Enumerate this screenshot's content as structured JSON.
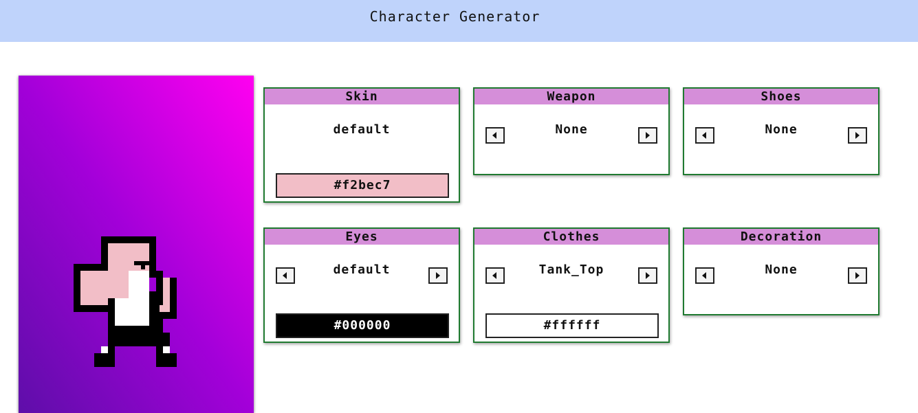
{
  "header": {
    "title": "Character Generator"
  },
  "preview": {
    "gradient": [
      "#5e0ea9",
      "#a300d9",
      "#ff00f0"
    ],
    "skin_color": "#f2bec7",
    "eye_color": "#000000",
    "clothes_color": "#ffffff"
  },
  "panels": {
    "skin": {
      "title": "Skin",
      "value": "default",
      "color": "#f2bec7",
      "color_label": "#f2bec7"
    },
    "weapon": {
      "title": "Weapon",
      "value": "None"
    },
    "shoes": {
      "title": "Shoes",
      "value": "None"
    },
    "eyes": {
      "title": "Eyes",
      "value": "default",
      "color": "#000000",
      "color_label": "#000000"
    },
    "clothes": {
      "title": "Clothes",
      "value": "Tank_Top",
      "color": "#ffffff",
      "color_label": "#ffffff"
    },
    "decoration": {
      "title": "Decoration",
      "value": "None"
    }
  }
}
